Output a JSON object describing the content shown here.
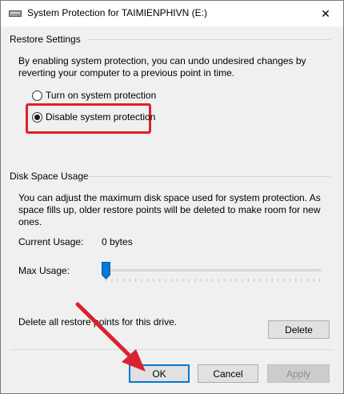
{
  "window": {
    "title": "System Protection for TAIMIENPHIVN (E:)",
    "close_glyph": "✕"
  },
  "restore_settings": {
    "header": "Restore Settings",
    "description_line1": "By enabling system protection, you can undo undesired changes by",
    "description_line2": "reverting your computer to a previous point in time.",
    "options": [
      {
        "label": "Turn on system protection",
        "selected": false
      },
      {
        "label": "Disable system protection",
        "selected": true
      }
    ]
  },
  "disk_space": {
    "header": "Disk Space Usage",
    "description_line1": "You can adjust the maximum disk space used for system protection. As",
    "description_line2": "space fills up, older restore points will be deleted to make room for new",
    "description_line3": "ones.",
    "current_usage_label": "Current Usage:",
    "current_usage_value": "0 bytes",
    "max_usage_label": "Max Usage:",
    "max_usage_fraction": 0.0,
    "delete_text": "Delete all restore points for this drive.",
    "delete_button": "Delete"
  },
  "buttons": {
    "ok": "OK",
    "cancel": "Cancel",
    "apply": "Apply"
  },
  "colors": {
    "highlight_red": "#e0202a",
    "slider_thumb": "#0078d7",
    "arrow_red": "#d9232d"
  }
}
